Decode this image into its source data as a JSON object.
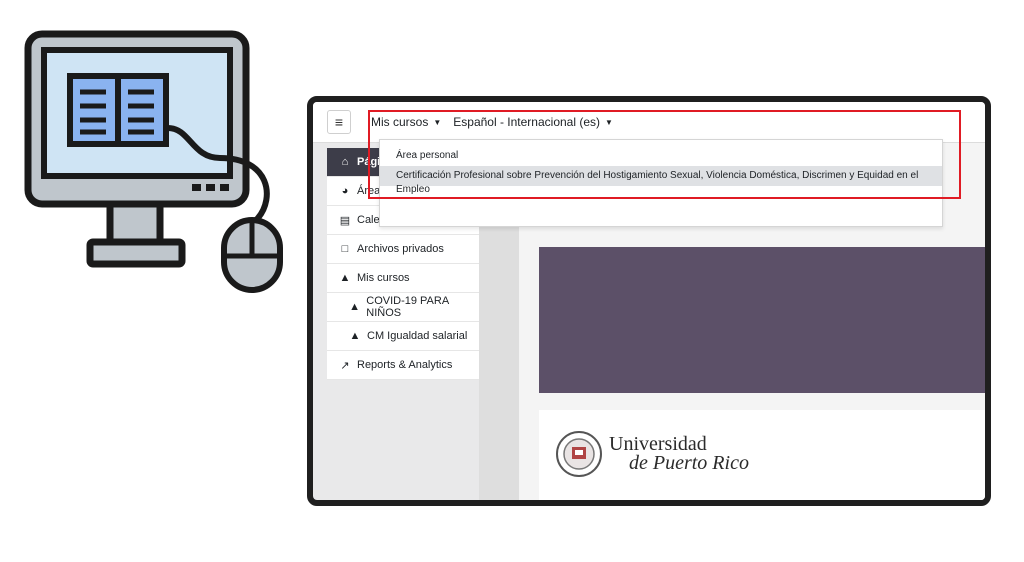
{
  "topbar": {
    "menu_icon": "hamburger-icon",
    "my_courses": "Mis cursos",
    "language": "Español - Internacional (es)"
  },
  "dropdown": {
    "items": [
      "Área personal",
      "Certificación Profesional sobre Prevención del Hostigamiento Sexual, Violencia Doméstica, Discrimen y Equidad en el Empleo"
    ]
  },
  "sidebar": {
    "items": [
      {
        "label": "Página",
        "icon": "home-icon"
      },
      {
        "label": "Área p",
        "icon": "dashboard-icon"
      },
      {
        "label": "Calendario",
        "icon": "calendar-icon"
      },
      {
        "label": "Archivos privados",
        "icon": "file-icon"
      },
      {
        "label": "Mis cursos",
        "icon": "graduation-cap-icon"
      },
      {
        "label": "COVID-19 PARA NIÑOS",
        "icon": "graduation-cap-icon"
      },
      {
        "label": "CM Igualdad salarial",
        "icon": "graduation-cap-icon"
      },
      {
        "label": "Reports & Analytics",
        "icon": "chart-line-icon"
      }
    ]
  },
  "university": {
    "line1": "Universidad",
    "line2": "de Puerto Rico"
  },
  "colors": {
    "highlight_box": "#e01b24",
    "sidebar_active": "#3d3d49",
    "banner": "#5c5068"
  }
}
